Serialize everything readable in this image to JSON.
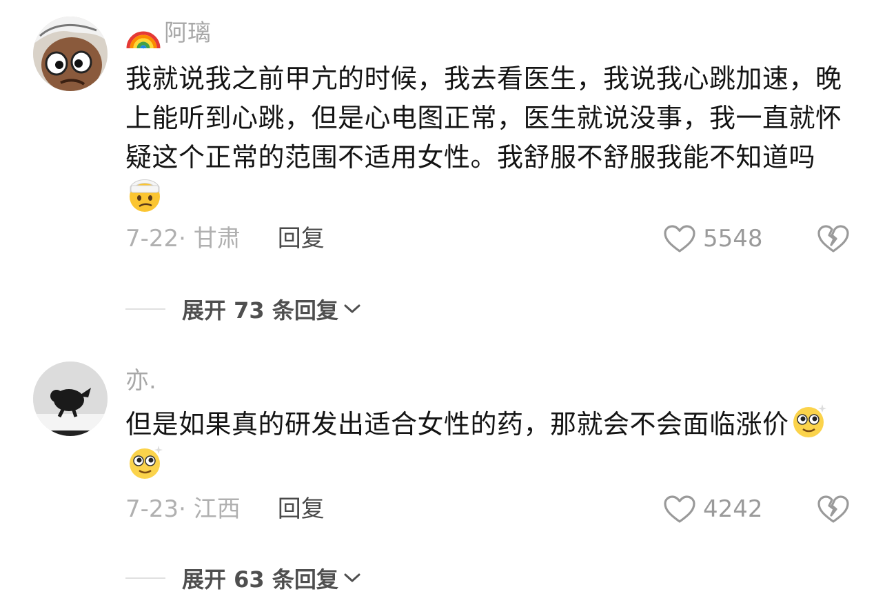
{
  "comments": [
    {
      "username": "阿璃",
      "badge_icon": "rainbow-icon",
      "avatar_icon": "cartoon-face-avatar",
      "text": "我就说我之前甲亢的时候，我去看医生，我说我心跳加速，晚上能听到心跳，但是心电图正常，医生就说没事，我一直就怀疑这个正常的范围不适用女性。我舒服不舒服我能不知道吗",
      "emoji": "bandaged-face-emoji",
      "date_location": "7-22· 甘肃",
      "reply_label": "回复",
      "likes": "5548",
      "expand_label": "展开 73 条回复"
    },
    {
      "username": "亦.",
      "avatar_icon": "black-cat-avatar",
      "text": "但是如果真的研发出适合女性的药，那就会不会面临涨价",
      "emoji": "sparkle-eyes-emoji",
      "date_location": "7-23· 江西",
      "reply_label": "回复",
      "likes": "4242",
      "expand_label": "展开 63 条回复"
    }
  ],
  "colors": {
    "text": "#141414",
    "muted": "#a8a8a8",
    "reply": "#4a4a4a",
    "icon": "#9a9a9a"
  }
}
